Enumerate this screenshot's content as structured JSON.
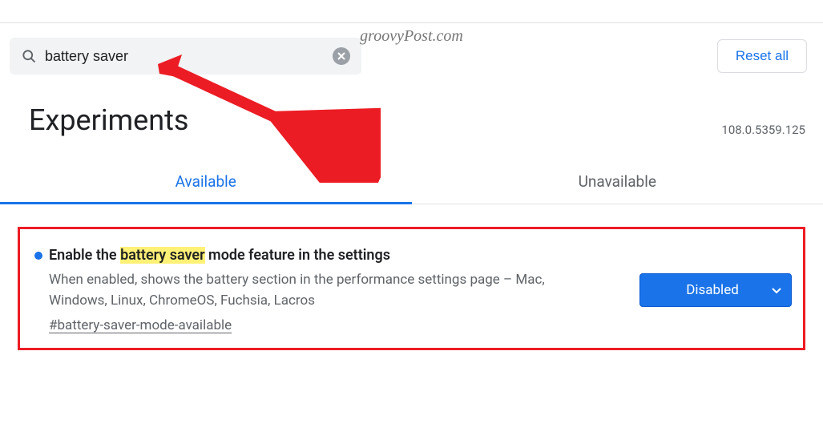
{
  "watermark": "groovyPost.com",
  "search": {
    "value": "battery saver"
  },
  "reset_label": "Reset all",
  "page_title": "Experiments",
  "version": "108.0.5359.125",
  "tabs": {
    "available": "Available",
    "unavailable": "Unavailable"
  },
  "flag": {
    "title_pre": "Enable the ",
    "title_hl": "battery saver",
    "title_post": " mode feature in the settings",
    "description": "When enabled, shows the battery section in the performance settings page – Mac, Windows, Linux, ChromeOS, Fuchsia, Lacros",
    "id": "#battery-saver-mode-available",
    "select_value": "Disabled"
  }
}
